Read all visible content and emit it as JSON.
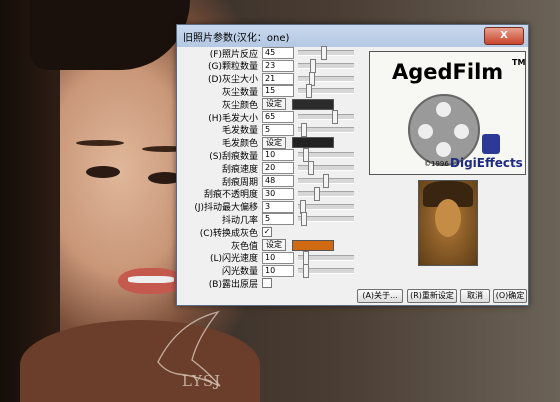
{
  "dialog": {
    "title": "旧照片参数(汉化：one)",
    "close_label": "X"
  },
  "params": [
    {
      "label": "(F)照片反应",
      "value": "45",
      "thumb": 0.45
    },
    {
      "label": "(G)颗粒数量",
      "value": "23",
      "thumb": 0.23
    },
    {
      "label": "(D)灰尘大小",
      "value": "21",
      "thumb": 0.21
    },
    {
      "label": "灰尘数量",
      "value": "15",
      "thumb": 0.15
    },
    {
      "label": "灰尘颜色",
      "button": "设定",
      "color": "#2b2b2b"
    },
    {
      "label": "(H)毛发大小",
      "value": "65",
      "thumb": 0.65
    },
    {
      "label": "毛发数量",
      "value": "5",
      "thumb": 0.05
    },
    {
      "label": "毛发颜色",
      "button": "设定",
      "color": "#222222"
    },
    {
      "label": "(S)刮痕数量",
      "value": "10",
      "thumb": 0.1
    },
    {
      "label": "刮痕速度",
      "value": "20",
      "thumb": 0.2
    },
    {
      "label": "刮痕周期",
      "value": "48",
      "thumb": 0.48
    },
    {
      "label": "刮痕不透明度",
      "value": "30",
      "thumb": 0.3
    },
    {
      "label": "(J)抖动最大偏移",
      "value": "3",
      "thumb": 0.03
    },
    {
      "label": "抖动几率",
      "value": "5",
      "thumb": 0.05
    },
    {
      "label": "(C)转换成灰色",
      "checkbox": true,
      "checked": true
    },
    {
      "label": "灰色值",
      "button": "设定",
      "color": "#d06a12"
    },
    {
      "label": "(L)闪光速度",
      "value": "10",
      "thumb": 0.1
    },
    {
      "label": "闪光数量",
      "value": "10",
      "thumb": 0.1
    },
    {
      "label": "(B)露出原层",
      "checkbox": true,
      "checked": false
    }
  ],
  "logo": {
    "title": "AgedFilm",
    "tm": "TM",
    "copyright": "©1996",
    "brand": "DigiEffects"
  },
  "buttons": {
    "about": "(A)关于...",
    "reset": "(R)重新设定",
    "cancel": "取消",
    "ok": "(O)确定"
  },
  "watermark": "LYSJ"
}
